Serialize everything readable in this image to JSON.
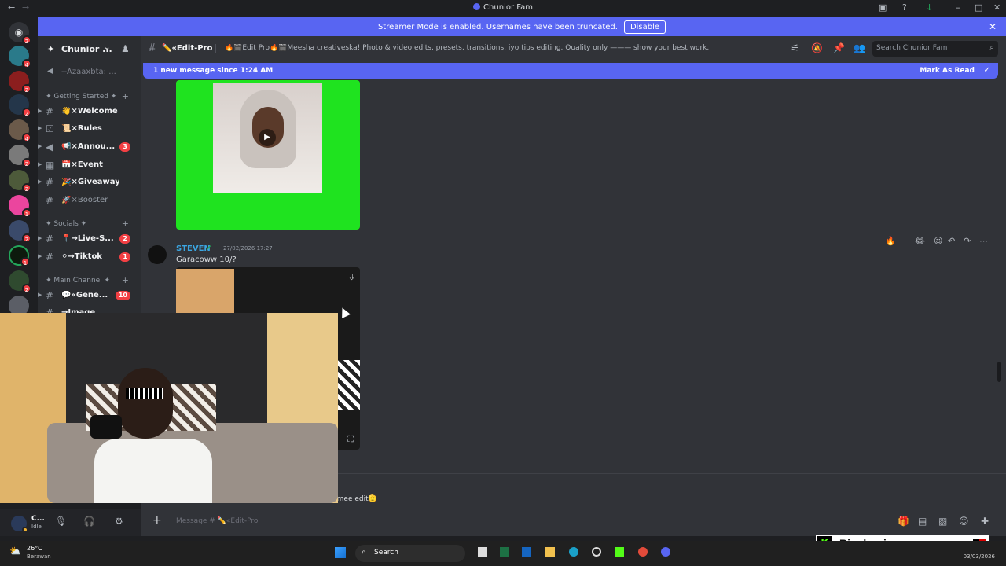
{
  "window": {
    "title": "Chunior Fam"
  },
  "banner": {
    "text": "Streamer Mode is enabled. Usernames have been truncated.",
    "button": "Disable"
  },
  "guild": {
    "name": "Chunior ..."
  },
  "sidebar": {
    "voice_top": "--Azaaxbta: ...",
    "categories": [
      {
        "label": "✦ Getting Started ✦"
      },
      {
        "label": "✦ Socials ✦"
      },
      {
        "label": "✦ Main Channel ✦"
      }
    ],
    "channels": [
      {
        "label": "👋×Welcome",
        "count": ""
      },
      {
        "label": "📜×Rules",
        "count": ""
      },
      {
        "label": "📢×Annou...",
        "count": "3"
      },
      {
        "label": "📅×Event",
        "count": ""
      },
      {
        "label": "🎉×Giveaways",
        "count": ""
      },
      {
        "label": "🚀×Booster",
        "count": ""
      },
      {
        "label": "📍→Live-S...",
        "count": "2"
      },
      {
        "label": "⚪→Tiktok",
        "count": "1"
      },
      {
        "label": "💬«Gene...",
        "count": "10"
      },
      {
        "label": "→Image",
        "count": ""
      }
    ]
  },
  "channel_header": {
    "name": "✏️«Edit-Pro",
    "topic": "🔥🎬Edit Pro🔥🎬Meesha creativeska! Photo & video edits, presets, transitions, iyo tips editing. Quality only ——— show your best work.",
    "search_placeholder": "Search Chunior Fam"
  },
  "new_messages_bar": {
    "text": "1 new message since 1:24 AM",
    "mark_read": "Mark As Read"
  },
  "messages": [
    {
      "author": "STEVEN",
      "timestamp": "27/02/2026 17:27",
      "text": "Garacoww 10/?"
    },
    {
      "author": "",
      "timestamp": "",
      "text": "...qorsh iyo video ya tabka anaa sameyaay qimee edit🫡"
    }
  ],
  "composer": {
    "placeholder": "Message # ✏️«Edit-Pro"
  },
  "user_panel": {
    "name": "C...",
    "status": "Idle"
  },
  "taskbar": {
    "weather_temp": "26°C",
    "weather_desc": "Berawan",
    "search": "Search",
    "date": "03/03/2026"
  },
  "overlay": {
    "streamer_name": "Bigchunior"
  },
  "colors": {
    "accent": "#5865f2",
    "bg_dark": "#1e1f22",
    "sidebar": "#2b2d31",
    "chat": "#313338",
    "badge_red": "#f23f43",
    "green_screen": "#1fe31f"
  }
}
